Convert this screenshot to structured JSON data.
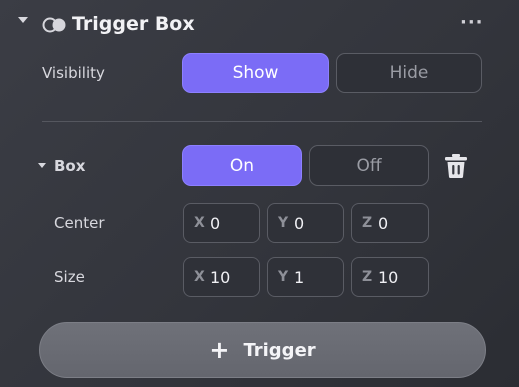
{
  "header": {
    "title": "Trigger Box",
    "more": "···"
  },
  "visibility": {
    "label": "Visibility",
    "show_label": "Show",
    "hide_label": "Hide",
    "selected": "Show"
  },
  "box": {
    "label": "Box",
    "on_label": "On",
    "off_label": "Off",
    "selected": "On",
    "center": {
      "label": "Center",
      "x_label": "X",
      "x": "0",
      "y_label": "Y",
      "y": "0",
      "z_label": "Z",
      "z": "0"
    },
    "size": {
      "label": "Size",
      "x_label": "X",
      "x": "10",
      "y_label": "Y",
      "y": "1",
      "z_label": "Z",
      "z": "10"
    }
  },
  "footer": {
    "add_label": "Trigger",
    "plus": "+"
  },
  "colors": {
    "accent": "#7b6cf6",
    "panel_bg": "#36383f",
    "button_off_bg": "#2e3037"
  }
}
